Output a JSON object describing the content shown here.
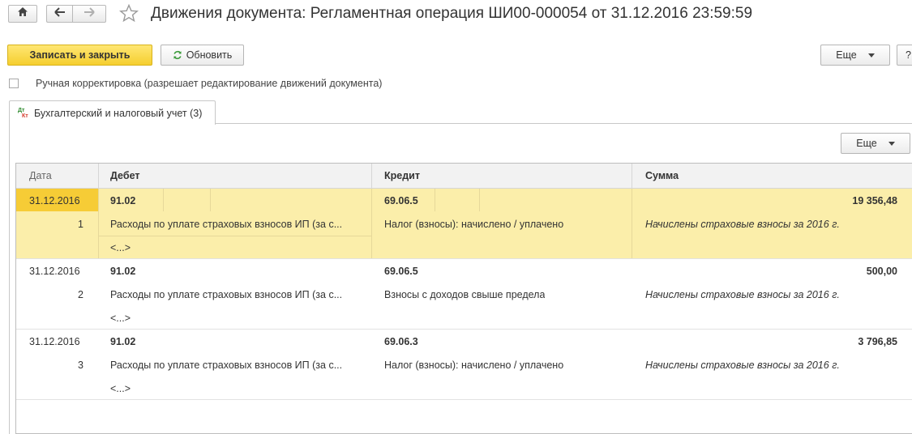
{
  "window": {
    "title": "Движения документа: Регламентная операция ШИ00-000054 от 31.12.2016 23:59:59"
  },
  "toolbar": {
    "save_close_label": "Записать и закрыть",
    "refresh_label": "Обновить",
    "more_label": "Еще",
    "help_label": "?"
  },
  "manual_adjust": {
    "label": "Ручная корректировка (разрешает редактирование движений документа)",
    "checked": false
  },
  "tabs": [
    {
      "label": "Бухгалтерский и налоговый учет (3)",
      "active": true
    }
  ],
  "table_toolbar": {
    "more_label": "Еще"
  },
  "table": {
    "columns": [
      "Дата",
      "Дебет",
      "Кредит",
      "Сумма"
    ],
    "rows": [
      {
        "date": "31.12.2016",
        "number": "1",
        "debit_account": "91.02",
        "debit_subconto": "Расходы по уплате страховых взносов ИП (за с...",
        "debit_more": "<...>",
        "credit_account": "69.06.5",
        "credit_subconto": "Налог (взносы): начислено / уплачено",
        "amount": "19 356,48",
        "content": "Начислены страховые взносы за 2016 г.",
        "selected": true
      },
      {
        "date": "31.12.2016",
        "number": "2",
        "debit_account": "91.02",
        "debit_subconto": "Расходы по уплате страховых взносов ИП (за с...",
        "debit_more": "<...>",
        "credit_account": "69.06.5",
        "credit_subconto": "Взносы с доходов свыше предела",
        "amount": "500,00",
        "content": "Начислены страховые взносы за 2016 г.",
        "selected": false
      },
      {
        "date": "31.12.2016",
        "number": "3",
        "debit_account": "91.02",
        "debit_subconto": "Расходы по уплате страховых взносов ИП (за с...",
        "debit_more": "<...>",
        "credit_account": "69.06.3",
        "credit_subconto": "Налог (взносы): начислено / уплачено",
        "amount": "3 796,85",
        "content": "Начислены страховые взносы за 2016 г.",
        "selected": false
      }
    ]
  },
  "icons": {
    "home": "home-icon",
    "back": "arrow-left-icon",
    "forward": "arrow-right-icon",
    "favorite": "star-outline-icon",
    "refresh": "refresh-icon",
    "tab": "dt-kt-icon"
  },
  "colors": {
    "primary_button": "#f5cf2f",
    "selected_row": "#fbeeaa",
    "selected_cell": "#f6cc36",
    "refresh_icon": "#3a9a3a",
    "dt_green": "#2e8b2e",
    "kt_red": "#d33a2c"
  }
}
